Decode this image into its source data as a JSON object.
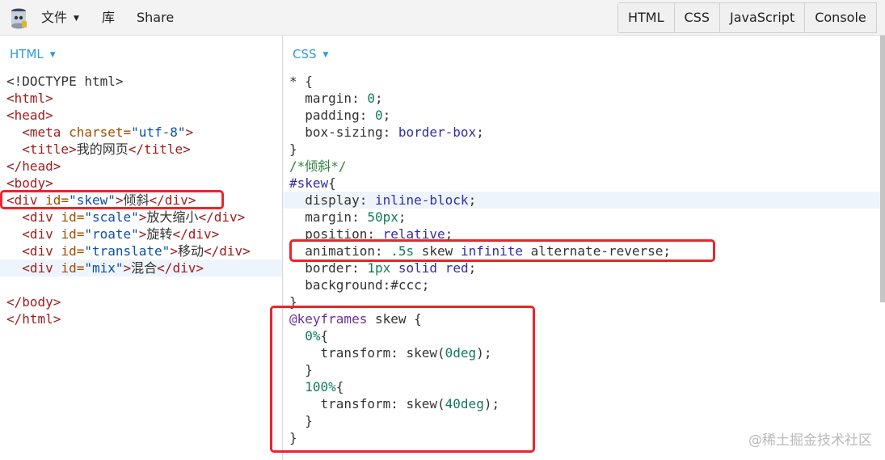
{
  "menu": {
    "file": "文件",
    "library": "库",
    "share": "Share"
  },
  "tabs": [
    "HTML",
    "CSS",
    "JavaScript",
    "Console"
  ],
  "html_pane": {
    "label": "HTML",
    "lines": [
      [
        [
          "plain",
          "<!DOCTYPE html>"
        ]
      ],
      [
        [
          "tag",
          "<html>"
        ]
      ],
      [
        [
          "tag",
          "<head>"
        ]
      ],
      [
        [
          "plain",
          "  "
        ],
        [
          "tag",
          "<meta "
        ],
        [
          "attr",
          "charset="
        ],
        [
          "str",
          "\"utf-8\""
        ],
        [
          "tag",
          ">"
        ]
      ],
      [
        [
          "plain",
          "  "
        ],
        [
          "tag",
          "<title>"
        ],
        [
          "plain",
          "我的网页"
        ],
        [
          "tag",
          "</title>"
        ]
      ],
      [
        [
          "tag",
          "</head>"
        ]
      ],
      [
        [
          "tag",
          "<body>"
        ]
      ],
      [
        [
          "tag",
          "<div "
        ],
        [
          "attr",
          "id="
        ],
        [
          "str",
          "\"skew\""
        ],
        [
          "tag",
          ">"
        ],
        [
          "plain",
          "倾斜"
        ],
        [
          "tag",
          "</div>"
        ]
      ],
      [
        [
          "plain",
          "  "
        ],
        [
          "tag",
          "<div "
        ],
        [
          "attr",
          "id="
        ],
        [
          "str",
          "\"scale\""
        ],
        [
          "tag",
          ">"
        ],
        [
          "plain",
          "放大缩小"
        ],
        [
          "tag",
          "</div>"
        ]
      ],
      [
        [
          "plain",
          "  "
        ],
        [
          "tag",
          "<div "
        ],
        [
          "attr",
          "id="
        ],
        [
          "str",
          "\"roate\""
        ],
        [
          "tag",
          ">"
        ],
        [
          "plain",
          "旋转"
        ],
        [
          "tag",
          "</div>"
        ]
      ],
      [
        [
          "plain",
          "  "
        ],
        [
          "tag",
          "<div "
        ],
        [
          "attr",
          "id="
        ],
        [
          "str",
          "\"translate\""
        ],
        [
          "tag",
          ">"
        ],
        [
          "plain",
          "移动"
        ],
        [
          "tag",
          "</div>"
        ]
      ],
      [
        [
          "plain",
          "  "
        ],
        [
          "tag",
          "<div "
        ],
        [
          "attr",
          "id="
        ],
        [
          "str",
          "\"mix\""
        ],
        [
          "tag",
          ">"
        ],
        [
          "plain",
          "混合"
        ],
        [
          "tag",
          "</div>"
        ]
      ],
      [
        [
          "plain",
          ""
        ]
      ],
      [
        [
          "tag",
          "</body>"
        ]
      ],
      [
        [
          "tag",
          "</html>"
        ]
      ]
    ],
    "highlight_line": 11
  },
  "css_pane": {
    "label": "CSS",
    "lines": [
      [
        [
          "plain",
          "* {"
        ]
      ],
      [
        [
          "plain",
          "  margin: "
        ],
        [
          "num",
          "0"
        ],
        [
          "plain",
          ";"
        ]
      ],
      [
        [
          "plain",
          "  padding: "
        ],
        [
          "num",
          "0"
        ],
        [
          "plain",
          ";"
        ]
      ],
      [
        [
          "plain",
          "  box-sizing: "
        ],
        [
          "kw",
          "border-box"
        ],
        [
          "plain",
          ";"
        ]
      ],
      [
        [
          "plain",
          "}"
        ]
      ],
      [
        [
          "comment",
          "/*倾斜*/"
        ]
      ],
      [
        [
          "kw",
          "#skew"
        ],
        [
          "plain",
          "{"
        ]
      ],
      [
        [
          "plain",
          "  display: "
        ],
        [
          "kw",
          "inline-block"
        ],
        [
          "plain",
          ";"
        ]
      ],
      [
        [
          "plain",
          "  margin: "
        ],
        [
          "num",
          "50px"
        ],
        [
          "plain",
          ";"
        ]
      ],
      [
        [
          "plain",
          "  position: "
        ],
        [
          "kw",
          "relative"
        ],
        [
          "plain",
          ";"
        ]
      ],
      [
        [
          "plain",
          "  animation: "
        ],
        [
          "num",
          ".5s"
        ],
        [
          "plain",
          " skew "
        ],
        [
          "kw",
          "infinite"
        ],
        [
          "plain",
          " alternate-reverse;"
        ]
      ],
      [
        [
          "plain",
          "  border: "
        ],
        [
          "num",
          "1px"
        ],
        [
          "plain",
          " "
        ],
        [
          "kw",
          "solid"
        ],
        [
          "plain",
          " "
        ],
        [
          "kw",
          "red"
        ],
        [
          "plain",
          ";"
        ]
      ],
      [
        [
          "plain",
          "  background:#ccc;"
        ]
      ],
      [
        [
          "plain",
          "}"
        ]
      ],
      [
        [
          "at",
          "@keyframes"
        ],
        [
          "plain",
          " skew {"
        ]
      ],
      [
        [
          "plain",
          "  "
        ],
        [
          "num",
          "0%"
        ],
        [
          "plain",
          "{"
        ]
      ],
      [
        [
          "plain",
          "    transform: skew("
        ],
        [
          "num",
          "0deg"
        ],
        [
          "plain",
          ");"
        ]
      ],
      [
        [
          "plain",
          "  }"
        ]
      ],
      [
        [
          "plain",
          "  "
        ],
        [
          "num",
          "100%"
        ],
        [
          "plain",
          "{"
        ]
      ],
      [
        [
          "plain",
          "    transform: skew("
        ],
        [
          "num",
          "40deg"
        ],
        [
          "plain",
          ");"
        ]
      ],
      [
        [
          "plain",
          "  }"
        ]
      ],
      [
        [
          "plain",
          "}"
        ]
      ]
    ],
    "highlight_line": 7
  },
  "watermark": "@稀土掘金技术社区",
  "colors": {
    "accent": "#2d9cdb",
    "annotation_red": "#e8262b"
  }
}
